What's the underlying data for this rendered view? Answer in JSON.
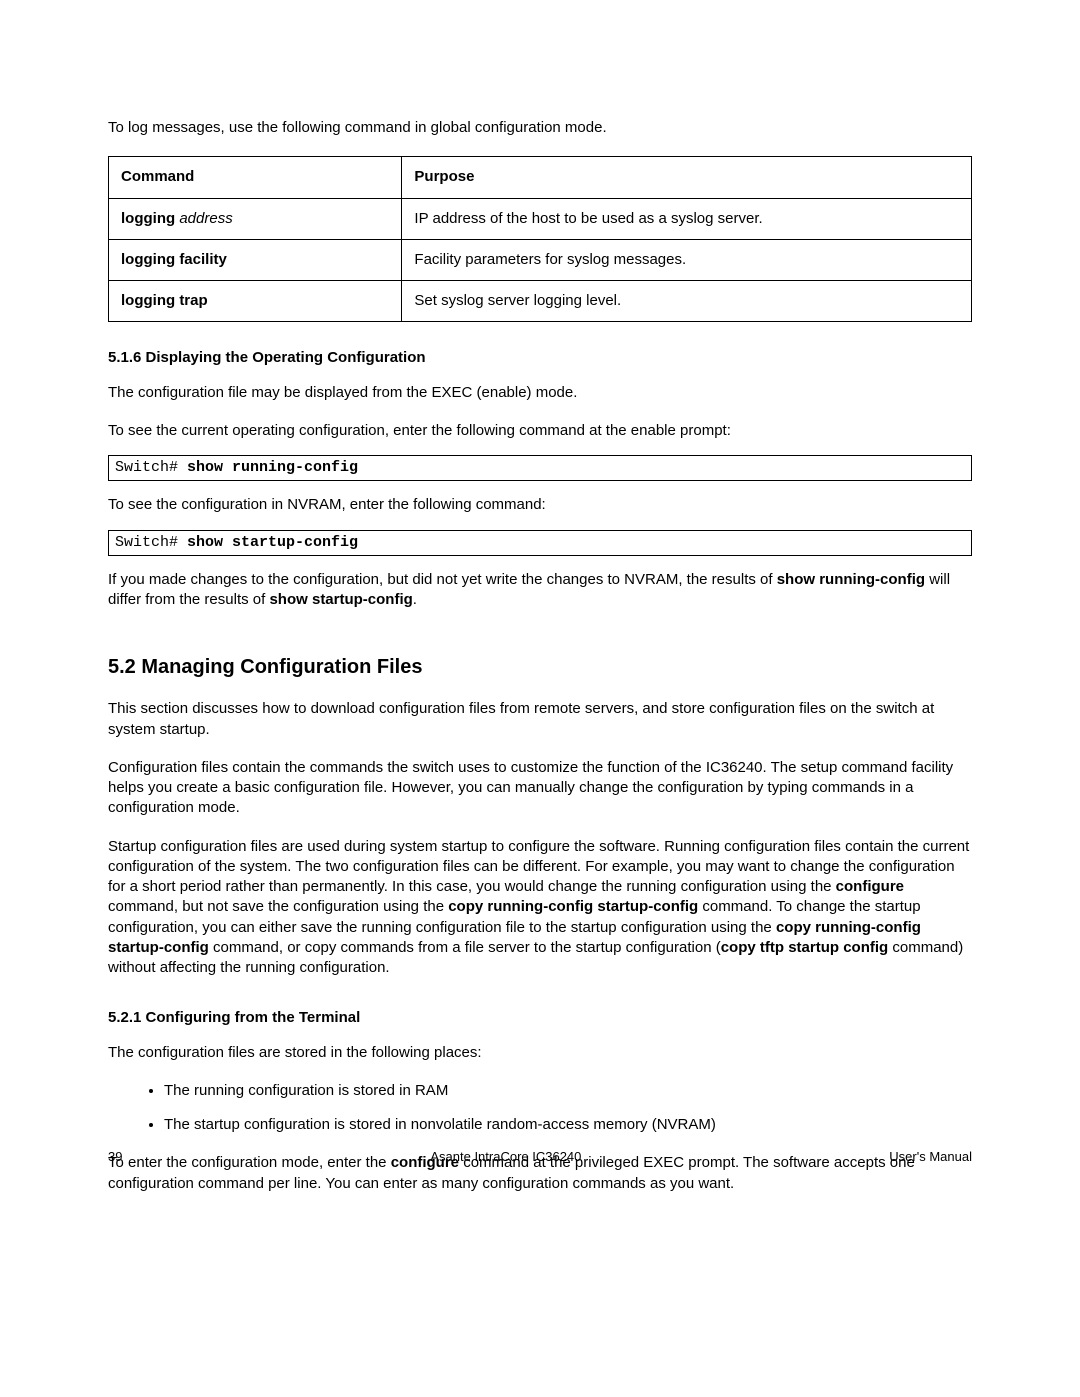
{
  "intro": "To log messages, use the following command in global configuration mode.",
  "table": {
    "headers": {
      "command": "Command",
      "purpose": "Purpose"
    },
    "rows": [
      {
        "cmd_bold": "logging",
        "cmd_italic": " address",
        "purpose": "IP address of the host to be used as a syslog server."
      },
      {
        "cmd_bold": "logging facility",
        "cmd_italic": "",
        "purpose": "Facility parameters for syslog messages."
      },
      {
        "cmd_bold": "logging trap",
        "cmd_italic": "",
        "purpose": "Set syslog server logging level."
      }
    ]
  },
  "s516": {
    "heading": "5.1.6 Displaying the Operating Configuration",
    "p1": "The configuration file may be displayed from the EXEC (enable) mode.",
    "p2": "To see the current operating configuration, enter the following command at the enable prompt:",
    "code1_prompt": "Switch# ",
    "code1_cmd": "show running-config",
    "p3": "To see the configuration in NVRAM, enter the following command:",
    "code2_prompt": "Switch# ",
    "code2_cmd": "show startup-config",
    "p4_a": "If you made changes to the configuration, but did not yet write the changes to NVRAM, the results of ",
    "p4_b": "show running-config",
    "p4_c": " will differ from the results of ",
    "p4_d": "show startup-config",
    "p4_e": "."
  },
  "s52": {
    "heading": "5.2 Managing Configuration Files",
    "p1": "This section discusses how to download configuration files from remote servers, and store configuration files on the switch at system startup.",
    "p2": "Configuration files contain the commands the switch uses to customize the function of the IC36240. The setup command facility helps you create a basic configuration file. However, you can manually change the configuration by typing commands in a configuration mode.",
    "p3_a": "Startup configuration files are used during system startup to configure the software. Running configuration files contain the current configuration of the system. The two configuration files can be different. For example, you may want to change the configuration for a short period rather than permanently. In this case, you would change the running configuration using the ",
    "p3_b": "configure",
    "p3_c": " command, but not save the configuration using the ",
    "p3_d": "copy running-config startup-config",
    "p3_e": " command. To change the startup configuration, you can either save the running configuration file to the startup configuration using the ",
    "p3_f": "copy running-config startup-config",
    "p3_g": " command, or copy commands from a file server to the startup configuration (",
    "p3_h": "copy tftp startup config",
    "p3_i": " command) without affecting the running configuration."
  },
  "s521": {
    "heading": "5.2.1 Configuring from the Terminal",
    "p1": "The configuration files are stored in the following places:",
    "bullets": [
      "The running configuration is stored in RAM",
      "The startup configuration is stored in nonvolatile random-access memory (NVRAM)"
    ],
    "p2_a": "To enter the configuration mode, enter the ",
    "p2_b": "configure",
    "p2_c": " command at the privileged EXEC prompt. The software accepts one configuration command per line. You can enter as many configuration commands as you want."
  },
  "footer": {
    "page": "39",
    "center": "Asante IntraCore IC36240",
    "right": "User's Manual"
  }
}
